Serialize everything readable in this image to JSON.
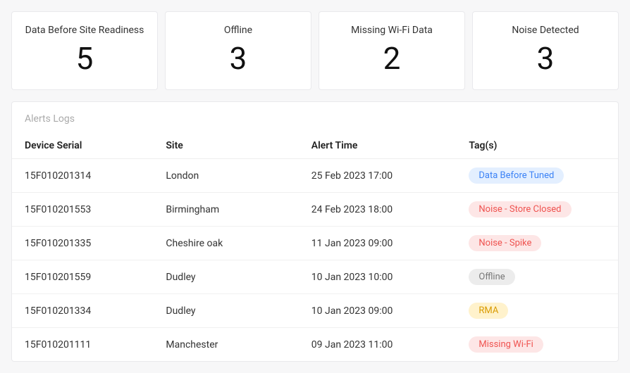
{
  "stats": [
    {
      "label": "Data Before Site Readiness",
      "value": "5"
    },
    {
      "label": "Offline",
      "value": "3"
    },
    {
      "label": "Missing Wi-Fi Data",
      "value": "2"
    },
    {
      "label": "Noise Detected",
      "value": "3"
    }
  ],
  "logs": {
    "title": "Alerts Logs",
    "headers": {
      "serial": "Device Serial",
      "site": "Site",
      "time": "Alert Time",
      "tags": "Tag(s)"
    },
    "rows": [
      {
        "serial": "15F010201314",
        "site": "London",
        "time": "25 Feb 2023 17:00",
        "tag": "Data Before Tuned",
        "tagClass": "tag-blue"
      },
      {
        "serial": "15F010201553",
        "site": "Birmingham",
        "time": "24 Feb 2023 18:00",
        "tag": "Noise - Store Closed",
        "tagClass": "tag-red"
      },
      {
        "serial": "15F010201335",
        "site": "Cheshire oak",
        "time": "11 Jan 2023 09:00",
        "tag": "Noise - Spike",
        "tagClass": "tag-red"
      },
      {
        "serial": "15F010201559",
        "site": "Dudley",
        "time": "10 Jan 2023 10:00",
        "tag": "Offline",
        "tagClass": "tag-gray"
      },
      {
        "serial": "15F010201334",
        "site": "Dudley",
        "time": "10 Jan 2023 09:00",
        "tag": "RMA",
        "tagClass": "tag-yellow"
      },
      {
        "serial": "15F010201111",
        "site": "Manchester",
        "time": "09 Jan 2023 11:00",
        "tag": "Missing Wi-Fi",
        "tagClass": "tag-red"
      }
    ]
  }
}
